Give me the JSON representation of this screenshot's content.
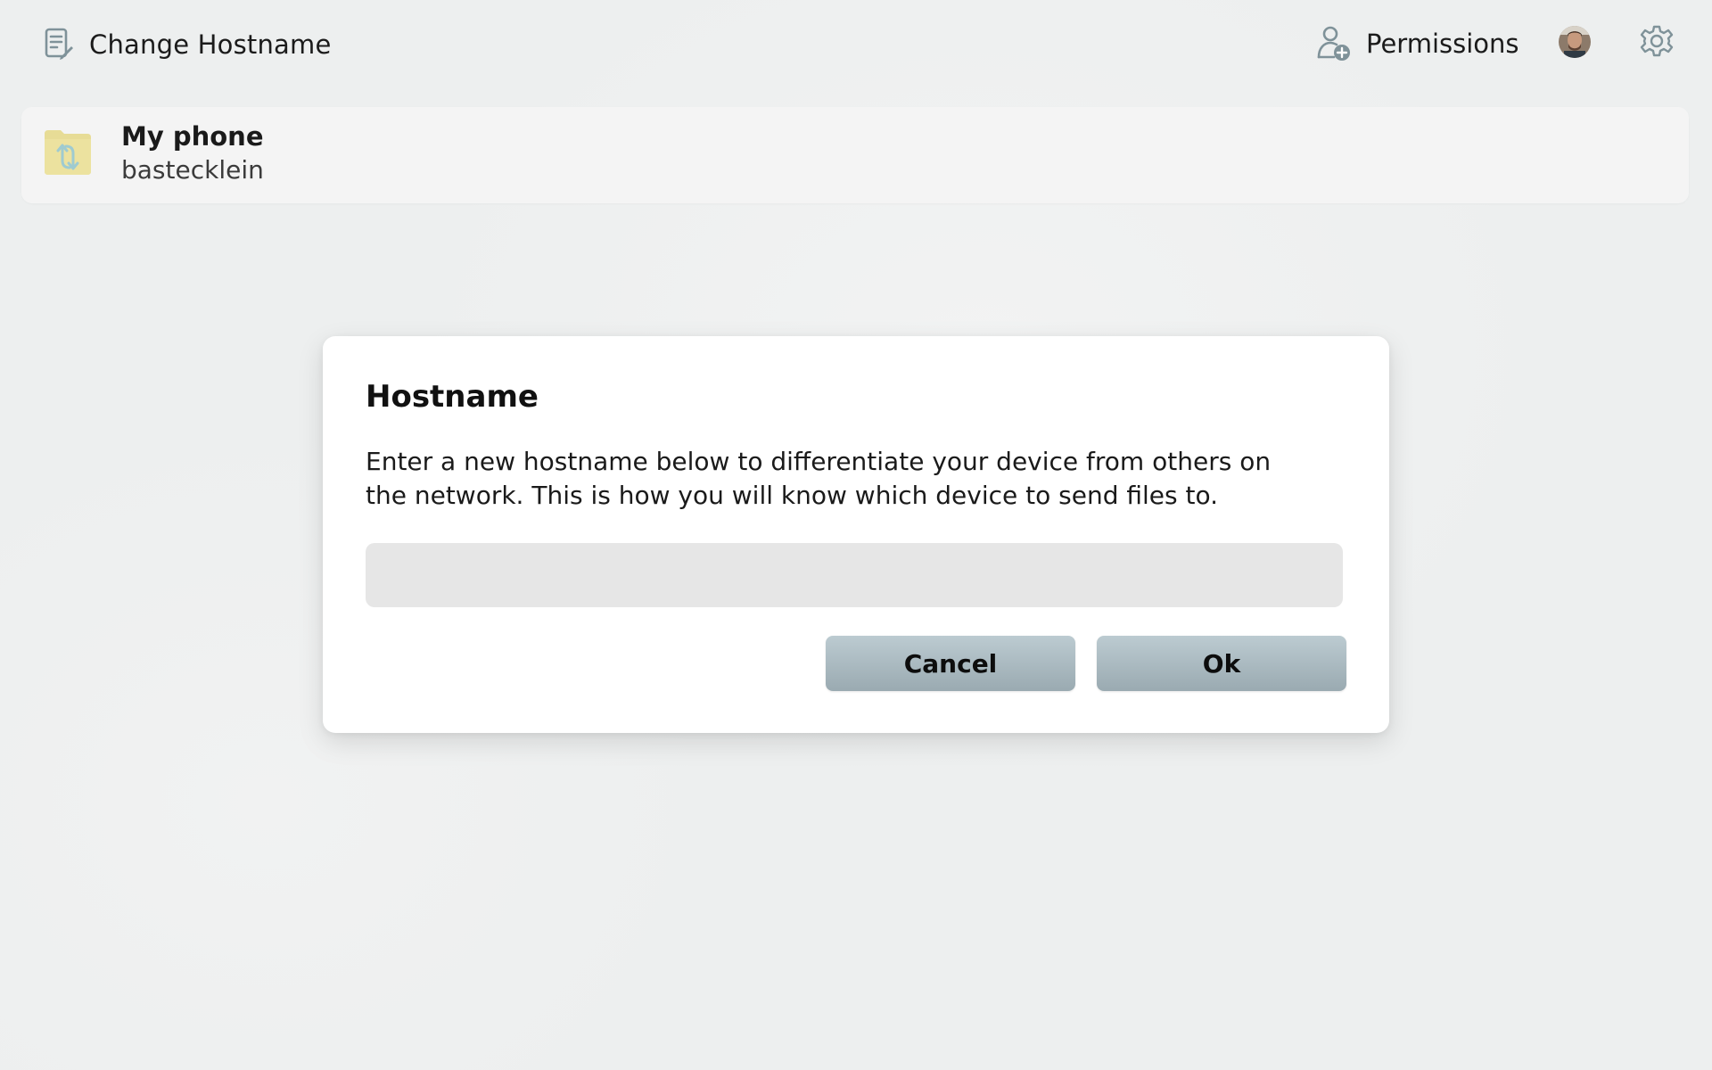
{
  "header": {
    "title": "Change Hostname",
    "title_icon": "edit-document-icon",
    "permissions_label": "Permissions",
    "permissions_icon": "user-add-icon",
    "settings_icon": "gear-icon"
  },
  "device": {
    "name": "My phone",
    "hostname": "bastecklein",
    "icon": "folder-sync-icon"
  },
  "dialog": {
    "title": "Hostname",
    "description": "Enter a new hostname below to differentiate your device from others on the network. This is how you will know which device to send files to.",
    "input_value": "",
    "input_placeholder": "",
    "cancel_label": "Cancel",
    "ok_label": "Ok"
  },
  "colors": {
    "button_top": "#bccbd1",
    "button_bottom": "#9aaab1",
    "icon_accent": "#7f9299",
    "folder": "#ece29f",
    "input_bg": "#e6e6e6"
  }
}
